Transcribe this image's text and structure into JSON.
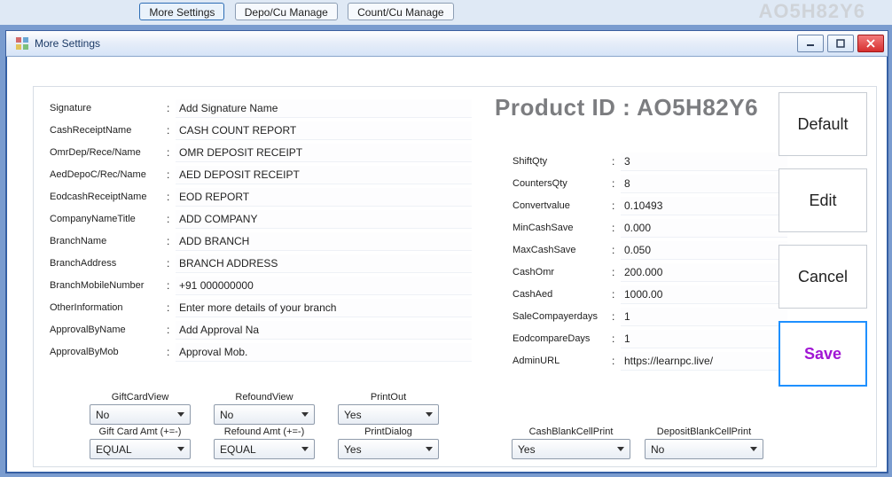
{
  "background": {
    "more_settings": "More Settings",
    "depo_cu_manage": "Depo/Cu Manage",
    "count_cu_manage": "Count/Cu Manage",
    "product_id_ghost": "AO5H82Y6"
  },
  "window": {
    "title": "More Settings"
  },
  "product_id_label": "Product ID : AO5H82Y6",
  "left_fields": [
    {
      "label": "Signature",
      "value": "Add Signature Name"
    },
    {
      "label": "CashReceiptName",
      "value": "CASH COUNT REPORT"
    },
    {
      "label": "OmrDep/Rece/Name",
      "value": "OMR DEPOSIT RECEIPT"
    },
    {
      "label": "AedDepoC/Rec/Name",
      "value": "AED DEPOSIT RECEIPT"
    },
    {
      "label": "EodcashReceiptName",
      "value": "EOD REPORT"
    },
    {
      "label": "CompanyNameTitle",
      "value": "ADD COMPANY"
    },
    {
      "label": "BranchName",
      "value": "ADD BRANCH"
    },
    {
      "label": "BranchAddress",
      "value": "BRANCH ADDRESS"
    },
    {
      "label": "BranchMobileNumber",
      "value": "+91 000000000"
    },
    {
      "label": "OtherInformation",
      "value": "Enter more details of your branch"
    },
    {
      "label": "ApprovalByName",
      "value": "Add Approval Na"
    },
    {
      "label": "ApprovalByMob",
      "value": "Approval Mob."
    }
  ],
  "right_fields": [
    {
      "label": "ShiftQty",
      "value": "3"
    },
    {
      "label": "CountersQty",
      "value": "8"
    },
    {
      "label": "Convertvalue",
      "value": "0.10493"
    },
    {
      "label": "MinCashSave",
      "value": "0.000"
    },
    {
      "label": "MaxCashSave",
      "value": "0.050"
    },
    {
      "label": "CashOmr",
      "value": "200.000"
    },
    {
      "label": "CashAed",
      "value": "1000.00"
    },
    {
      "label": "SaleCompayerdays",
      "value": "1"
    },
    {
      "label": "EodcompareDays",
      "value": "1"
    },
    {
      "label": "AdminURL",
      "value": "https://learnpc.live/"
    }
  ],
  "side_buttons": {
    "default": "Default",
    "edit": "Edit",
    "cancel": "Cancel",
    "save": "Save"
  },
  "combos_left": {
    "giftcardview_label": "GiftCardView",
    "giftcardview": "No",
    "refoundview_label": "RefoundView",
    "refoundview": "No",
    "printout_label": "PrintOut",
    "printout": "Yes",
    "giftcardamt_label": "Gift Card Amt (+=-)",
    "giftcardamt": "EQUAL",
    "refoundamt_label": "Refound Amt (+=-)",
    "refoundamt": "EQUAL",
    "printdialog_label": "PrintDialog",
    "printdialog": "Yes"
  },
  "combos_right": {
    "cashblank_label": "CashBlankCellPrint",
    "cashblank": "Yes",
    "depositblank_label": "DepositBlankCellPrint",
    "depositblank": "No"
  }
}
